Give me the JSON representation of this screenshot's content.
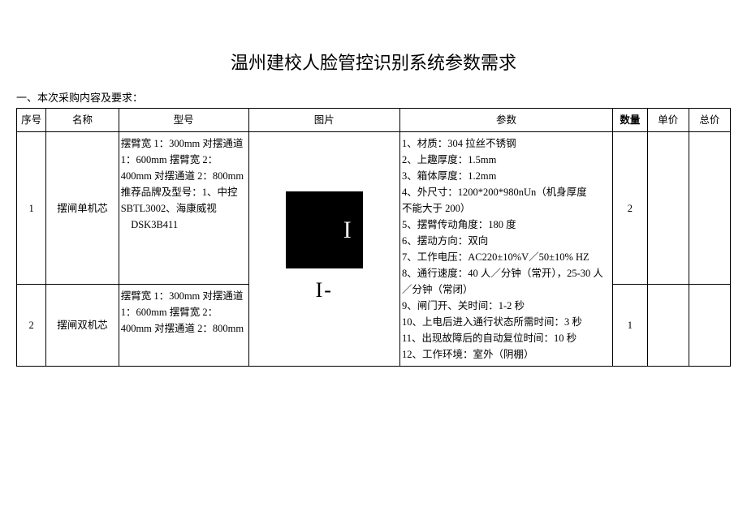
{
  "title": "温州建校人脸管控识别系统参数需求",
  "subtitle": "一、本次采购内容及要求：",
  "headers": {
    "seq": "序号",
    "name": "名称",
    "model": "型号",
    "image": "图片",
    "param": "参数",
    "qty": "数量",
    "unit_price": "单价",
    "total": "总价"
  },
  "rows": [
    {
      "seq": "1",
      "name": "摆闸单机芯",
      "model": "摆臂宽 1：300mm 对摆通道 1：600mm 摆臂宽 2：400mm 对摆通道 2：800mm 推荐品牌及型号：1、中控 SBTL3002、海康威视\n　DSK3B411",
      "qty": "2",
      "unit_price": "",
      "total": ""
    },
    {
      "seq": "2",
      "name": "摆闸双机芯",
      "model": "摆臂宽 1：300mm 对摆通道 1：600mm 摆臂宽 2：400mm 对摆通道 2：800mm",
      "qty": "1",
      "unit_price": "",
      "total": ""
    }
  ],
  "merged_param": "1、材质：304 拉丝不锈钢\n2、上趣厚度：1.5mm\n3、箱体厚度：1.2mm\n4、外尺寸：1200*200*980nUn（机身厚度\n不能大于 200）\n5、摆臂传动角度：180 度\n6、摆动方向：双向\n7、工作电压：AC220±10%V／50±10% HZ\n8、通行速度：40 人／分钟（常开），25-30 人／分钟（常闭）\n9、闸门开、关时间：1-2 秒\n10、上电后进入通行状态所需时间：3 秒\n11、出现故障后的自动复位时间：10 秒\n12、工作环境：室外（阴棚）",
  "image_glyph_top": "I",
  "image_glyph_bottom": "I-"
}
